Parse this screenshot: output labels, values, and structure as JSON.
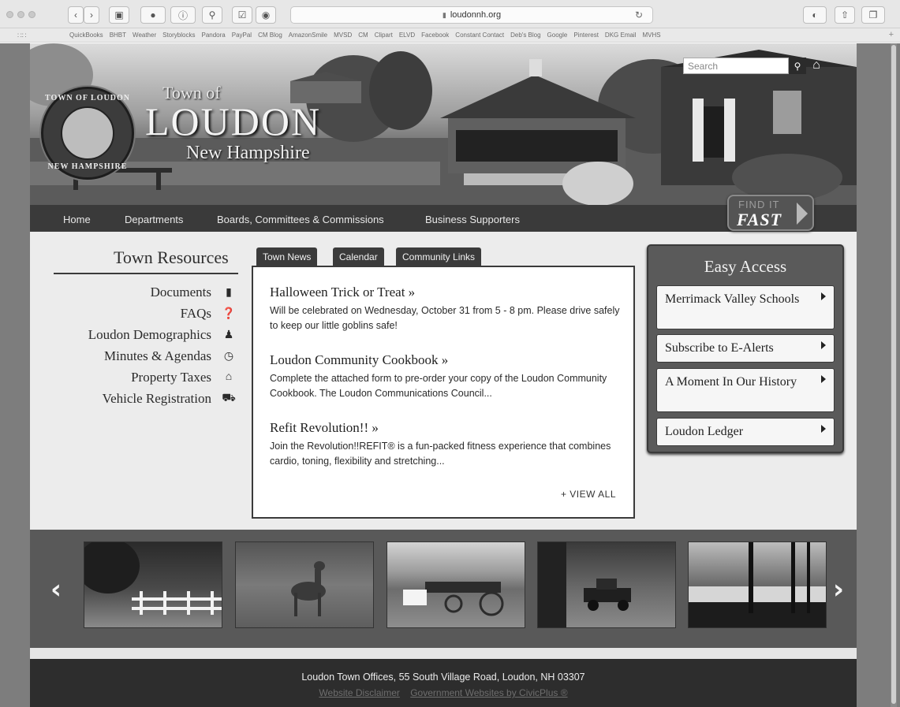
{
  "browser": {
    "url": "loudonnh.org",
    "bookmarks": [
      "QuickBooks",
      "BHBT",
      "Weather",
      "Storyblocks",
      "Pandora",
      "PayPal",
      "CM Blog",
      "AmazonSmile",
      "MVSD",
      "CM",
      "Clipart",
      "ELVD",
      "Facebook",
      "Constant Contact",
      "Deb's Blog",
      "Google",
      "Pinterest",
      "DKG Email",
      "MVHS"
    ],
    "icons": [
      "back-icon",
      "forward-icon",
      "sidebar-icon",
      "pinterest-icon",
      "info-icon",
      "accessibility-icon",
      "checkbox-icon",
      "camera-icon",
      "lock-icon",
      "reload-icon",
      "privacy-icon",
      "share-icon",
      "tabs-icon",
      "grid-icon",
      "plus-icon"
    ]
  },
  "header": {
    "town_of": "Town of",
    "town_name": "LOUDON",
    "state": "New Hampshire",
    "seal_top": "TOWN OF LOUDON",
    "seal_bottom": "NEW HAMPSHIRE",
    "search_placeholder": "Search"
  },
  "nav": {
    "items": [
      "Home",
      "Departments",
      "Boards, Committees & Commissions",
      "Business Supporters"
    ],
    "find_it": "FIND IT",
    "fast": "FAST"
  },
  "resources": {
    "title": "Town Resources",
    "items": [
      {
        "label": "Documents",
        "icon": "document-icon"
      },
      {
        "label": "FAQs",
        "icon": "question-icon"
      },
      {
        "label": "Loudon Demographics",
        "icon": "person-icon"
      },
      {
        "label": "Minutes & Agendas",
        "icon": "clock-icon"
      },
      {
        "label": "Property Taxes",
        "icon": "house-icon"
      },
      {
        "label": "Vehicle Registration",
        "icon": "car-icon"
      }
    ]
  },
  "news": {
    "tabs": [
      "Town News",
      "Calendar",
      "Community Links"
    ],
    "items": [
      {
        "title": "Halloween Trick or Treat »",
        "body": "Will be celebrated on Wednesday, October 31 from 5 - 8 pm. Please drive safely to keep our little goblins safe!"
      },
      {
        "title": "Loudon Community Cookbook »",
        "body": "Complete the attached form to pre-order your copy of the Loudon Community Cookbook. The Loudon Communications Council..."
      },
      {
        "title": "Refit Revolution!! »",
        "body": "Join the Revolution!!REFIT® is a fun-packed fitness experience that combines cardio, toning, flexibility and stretching..."
      }
    ],
    "view_all": "+ VIEW ALL"
  },
  "easy_access": {
    "title": "Easy Access",
    "items": [
      "Merrimack Valley Schools",
      "Subscribe to E-Alerts",
      "A Moment In Our History",
      "Loudon Ledger"
    ]
  },
  "footer": {
    "address": "Loudon Town Offices, 55 South Village Road, Loudon, NH 03307",
    "links": [
      "Website Disclaimer",
      "Government Websites by CivicPlus ®"
    ]
  }
}
